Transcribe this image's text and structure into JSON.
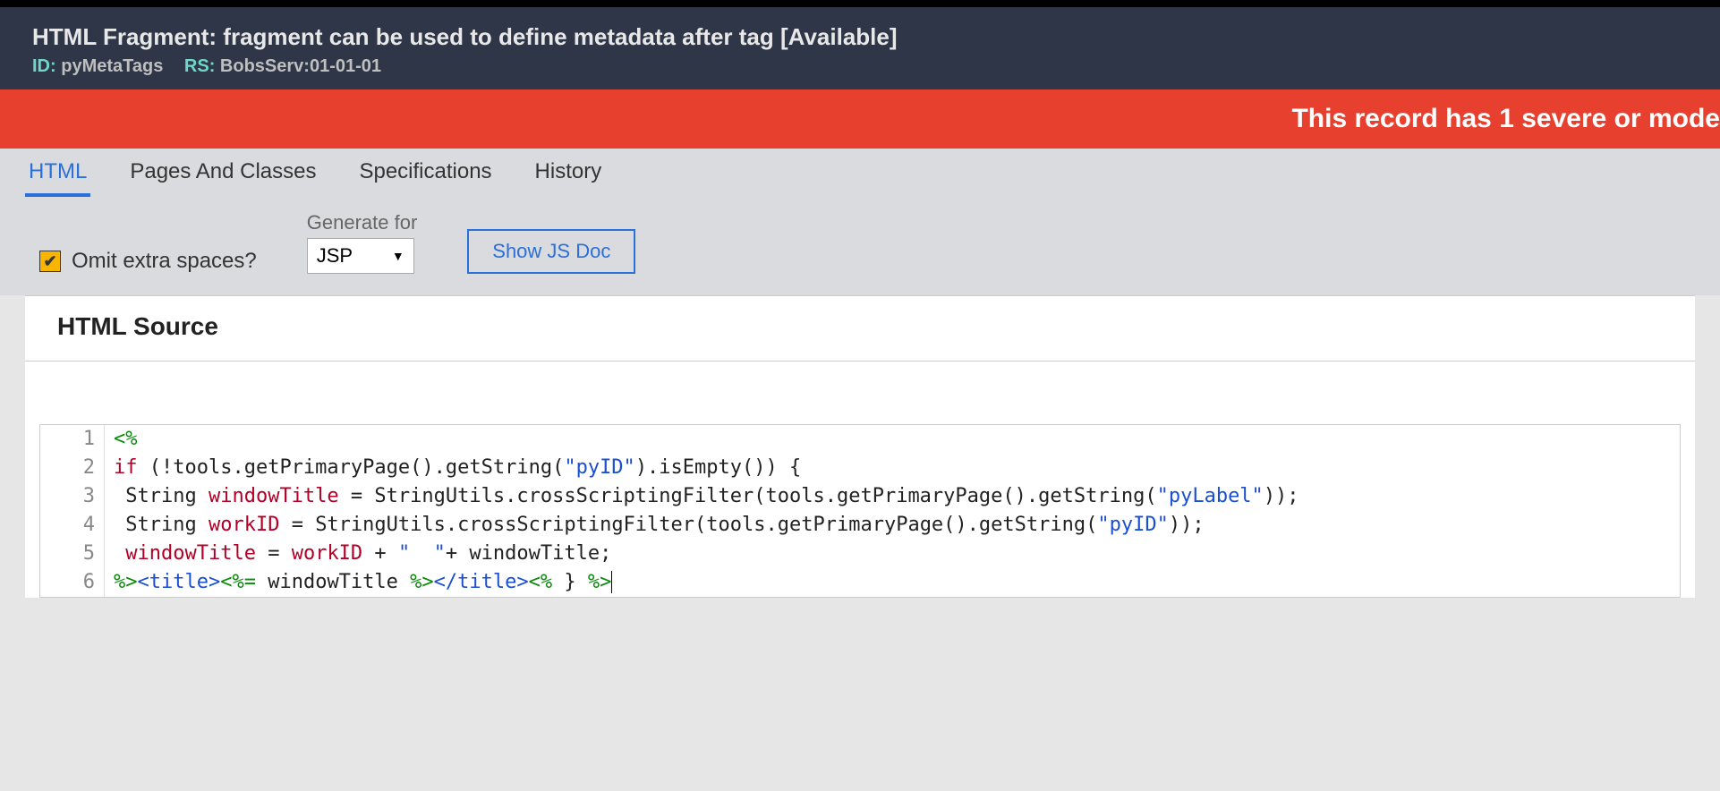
{
  "header": {
    "title": "HTML Fragment: fragment can be used to define metadata after tag [Available]",
    "id_label": "ID:",
    "id_value": "pyMetaTags",
    "rs_label": "RS:",
    "rs_value": "BobsServ:01-01-01"
  },
  "alert": "This record has 1 severe or mode",
  "tabs": [
    {
      "label": "HTML",
      "active": true
    },
    {
      "label": "Pages And Classes",
      "active": false
    },
    {
      "label": "Specifications",
      "active": false
    },
    {
      "label": "History",
      "active": false
    }
  ],
  "controls": {
    "omit_label": "Omit extra spaces?",
    "omit_checked": true,
    "generate_for_label": "Generate for",
    "generate_for_value": "JSP",
    "show_js_doc": "Show JS Doc"
  },
  "panel_title": "HTML Source",
  "code_lines": [
    {
      "n": "1",
      "tokens": [
        {
          "cls": "t-scriptlet",
          "text": "<%"
        }
      ]
    },
    {
      "n": "2",
      "tokens": [
        {
          "cls": "t-keyword",
          "text": "if"
        },
        {
          "cls": "t-plain",
          "text": " (!tools.getPrimaryPage().getString("
        },
        {
          "cls": "t-string",
          "text": "\"pyID\""
        },
        {
          "cls": "t-plain",
          "text": ").isEmpty()) {"
        }
      ]
    },
    {
      "n": "3",
      "tokens": [
        {
          "cls": "t-plain",
          "text": " String "
        },
        {
          "cls": "t-ident",
          "text": "windowTitle"
        },
        {
          "cls": "t-plain",
          "text": " = StringUtils.crossScriptingFilter(tools.getPrimaryPage().getString("
        },
        {
          "cls": "t-string",
          "text": "\"pyLabel\""
        },
        {
          "cls": "t-plain",
          "text": "));"
        }
      ]
    },
    {
      "n": "4",
      "tokens": [
        {
          "cls": "t-plain",
          "text": " String "
        },
        {
          "cls": "t-ident",
          "text": "workID"
        },
        {
          "cls": "t-plain",
          "text": " = StringUtils.crossScriptingFilter(tools.getPrimaryPage().getString("
        },
        {
          "cls": "t-string",
          "text": "\"pyID\""
        },
        {
          "cls": "t-plain",
          "text": "));"
        }
      ]
    },
    {
      "n": "5",
      "tokens": [
        {
          "cls": "t-plain",
          "text": " "
        },
        {
          "cls": "t-ident",
          "text": "windowTitle"
        },
        {
          "cls": "t-plain",
          "text": " = "
        },
        {
          "cls": "t-ident",
          "text": "workID"
        },
        {
          "cls": "t-plain",
          "text": " + "
        },
        {
          "cls": "t-string",
          "text": "\"  \""
        },
        {
          "cls": "t-plain",
          "text": "+ windowTitle;"
        }
      ]
    },
    {
      "n": "6",
      "tokens": [
        {
          "cls": "t-scriptlet",
          "text": "%>"
        },
        {
          "cls": "t-tag",
          "text": "<title>"
        },
        {
          "cls": "t-scriptlet",
          "text": "<%="
        },
        {
          "cls": "t-plain",
          "text": " windowTitle "
        },
        {
          "cls": "t-scriptlet",
          "text": "%>"
        },
        {
          "cls": "t-tag",
          "text": "</title>"
        },
        {
          "cls": "t-scriptlet",
          "text": "<%"
        },
        {
          "cls": "t-plain",
          "text": " } "
        },
        {
          "cls": "t-scriptlet",
          "text": "%>"
        }
      ]
    }
  ]
}
